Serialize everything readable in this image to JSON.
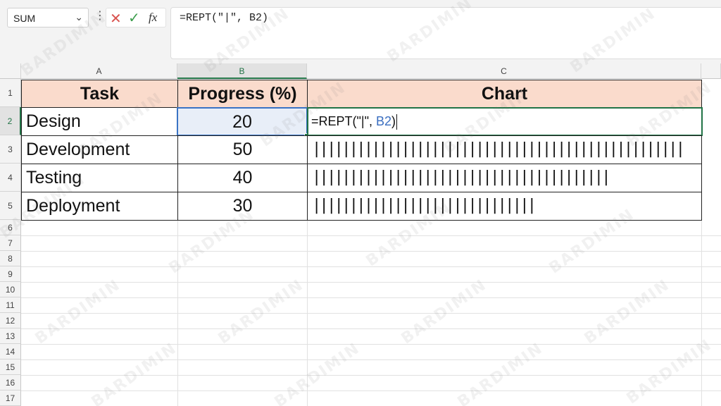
{
  "formula_bar": {
    "name_box": "SUM",
    "name_box_arrow": "⌄",
    "kebab": "⋮",
    "cancel_icon": "✕",
    "enter_icon": "✓",
    "insert_function": "fx",
    "formula": "=REPT(\"|\", B2)"
  },
  "columns": [
    "A",
    "B",
    "C"
  ],
  "rows": [
    "1",
    "2",
    "3",
    "4",
    "5",
    "6",
    "7",
    "8",
    "9",
    "10",
    "11",
    "12",
    "13",
    "14",
    "15",
    "16",
    "17"
  ],
  "active_cell": "B2",
  "table": {
    "headers": [
      "Task",
      "Progress (%)",
      "Chart"
    ],
    "rows": [
      {
        "task": "Design",
        "progress": "20",
        "chart": ""
      },
      {
        "task": "Development",
        "progress": "50",
        "chart": "||||||||||||||||||||||||||||||||||||||||||||||||||"
      },
      {
        "task": "Testing",
        "progress": "40",
        "chart": "||||||||||||||||||||||||||||||||||||||||"
      },
      {
        "task": "Deployment",
        "progress": "30",
        "chart": "||||||||||||||||||||||||||||||"
      }
    ]
  },
  "edit_cell": {
    "prefix": "=REPT(\"|\", ",
    "ref": "B2",
    "suffix": ")"
  },
  "watermark": "BARDIMIN",
  "colors": {
    "header_fill": "#fadbcc",
    "selection_blue": "#3a73c4",
    "edit_green": "#217346",
    "cancel_red": "#d9534f",
    "enter_green": "#3c9d4c"
  }
}
